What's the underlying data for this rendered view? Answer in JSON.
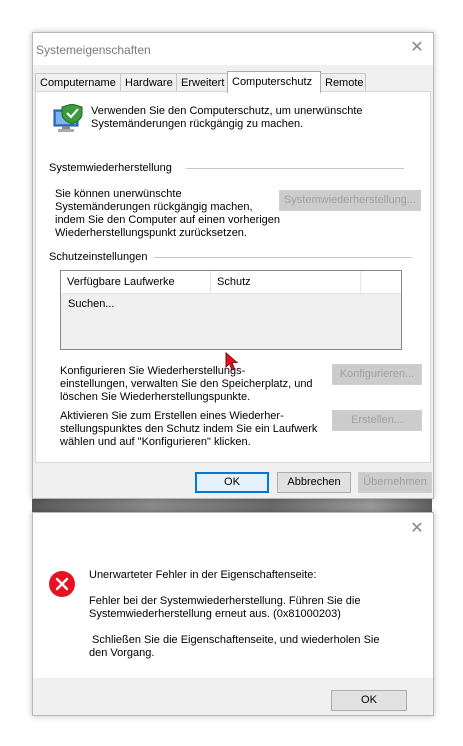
{
  "sysprops": {
    "title": "Systemeigenschaften",
    "close_glyph": "✕",
    "tabs": [
      "Computername",
      "Hardware",
      "Erweitert",
      "Computerschutz",
      "Remote"
    ],
    "active_tab": "Computerschutz",
    "intro_line1": "Verwenden Sie den Computerschutz, um unerwünschte",
    "intro_line2": "Systemänderungen rückgängig zu machen.",
    "restore_group": "Systemwiederherstellung",
    "restore_text": [
      "Sie können unerwünschte",
      "Systemänderungen rückgängig machen,",
      "indem Sie den Computer auf einen vorherigen",
      "Wiederherstellungspunkt zurücksetzen."
    ],
    "restore_button": "Systemwiederherstellung...",
    "protection_group": "Schutzeinstellungen",
    "columns": [
      "Verfügbare Laufwerke",
      "Schutz"
    ],
    "searching": "Suchen...",
    "configure_text": [
      "Konfigurieren Sie Wiederherstellungs-",
      "einstellungen, verwalten Sie den Speicherplatz, und",
      "löschen Sie Wiederherstellungspunkte."
    ],
    "configure_button": "Konfigurieren...",
    "create_text": [
      "Aktivieren Sie zum Erstellen eines Wiederher-",
      "stellungspunktes den Schutz indem Sie ein Laufwerk",
      "wählen und auf \"Konfigurieren\" klicken."
    ],
    "create_button": "Erstellen...",
    "ok": "OK",
    "cancel": "Abbrechen",
    "apply": "Übernehmen"
  },
  "error": {
    "close_glyph": "✕",
    "icon": "error-icon",
    "heading": "Unerwarteter Fehler in der Eigenschaftenseite:",
    "line1": "Fehler bei der Systemwiederherstellung. Führen Sie die",
    "line2": "Systemwiederherstellung erneut aus. (0x81000203)",
    "line3": " Schließen Sie die Eigenschaftenseite, und wiederholen Sie",
    "line4": "den Vorgang.",
    "ok": "OK"
  },
  "colors": {
    "error_red": "#e81123",
    "accent": "#0078d7"
  }
}
